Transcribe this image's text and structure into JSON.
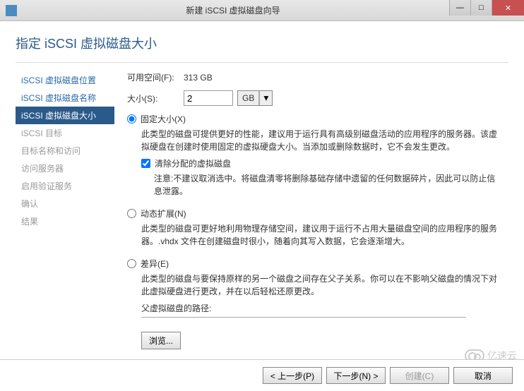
{
  "window": {
    "title": "新建 iSCSI 虚拟磁盘向导"
  },
  "header": {
    "title": "指定 iSCSI 虚拟磁盘大小"
  },
  "sidebar": {
    "items": [
      {
        "label": "iSCSI 虚拟磁盘位置",
        "state": "done"
      },
      {
        "label": "iSCSI 虚拟磁盘名称",
        "state": "done"
      },
      {
        "label": "iSCSI 虚拟磁盘大小",
        "state": "active"
      },
      {
        "label": "iSCSI 目标",
        "state": "disabled"
      },
      {
        "label": "目标名称和访问",
        "state": "disabled"
      },
      {
        "label": "访问服务器",
        "state": "disabled"
      },
      {
        "label": "启用验证服务",
        "state": "disabled"
      },
      {
        "label": "确认",
        "state": "disabled"
      },
      {
        "label": "结果",
        "state": "disabled"
      }
    ]
  },
  "main": {
    "free_space_label": "可用空间(F):",
    "free_space_value": "313 GB",
    "size_label": "大小(S):",
    "size_value": "2",
    "size_unit": "GB",
    "fixed": {
      "label": "固定大小(X)",
      "desc": "此类型的磁盘可提供更好的性能，建议用于运行具有高级别磁盘活动的应用程序的服务器。该虚拟硬盘在创建时使用固定的虚拟硬盘大小。当添加或删除数据时，它不会发生更改。",
      "clear_label": "清除分配的虚拟磁盘",
      "clear_desc": "注意:不建议取消选中。将磁盘清零将删除基础存储中遗留的任何数据碎片，因此可以防止信息泄露。"
    },
    "dynamic": {
      "label": "动态扩展(N)",
      "desc": "此类型的磁盘可更好地利用物理存储空间，建议用于运行不占用大量磁盘空间的应用程序的服务器。.vhdx 文件在创建磁盘时很小，随着向其写入数据，它会逐渐增大。"
    },
    "diff": {
      "label": "差异(E)",
      "desc": "此类型的磁盘与要保持原样的另一个磁盘之间存在父子关系。你可以在不影响父磁盘的情况下对此虚拟硬盘进行更改，并在以后轻松还原更改。",
      "parent_path_label": "父虚拟磁盘的路径:",
      "browse_label": "浏览..."
    }
  },
  "footer": {
    "prev": "< 上一步(P)",
    "next": "下一步(N) >",
    "create": "创建(C)",
    "cancel": "取消"
  },
  "watermark": "亿速云"
}
